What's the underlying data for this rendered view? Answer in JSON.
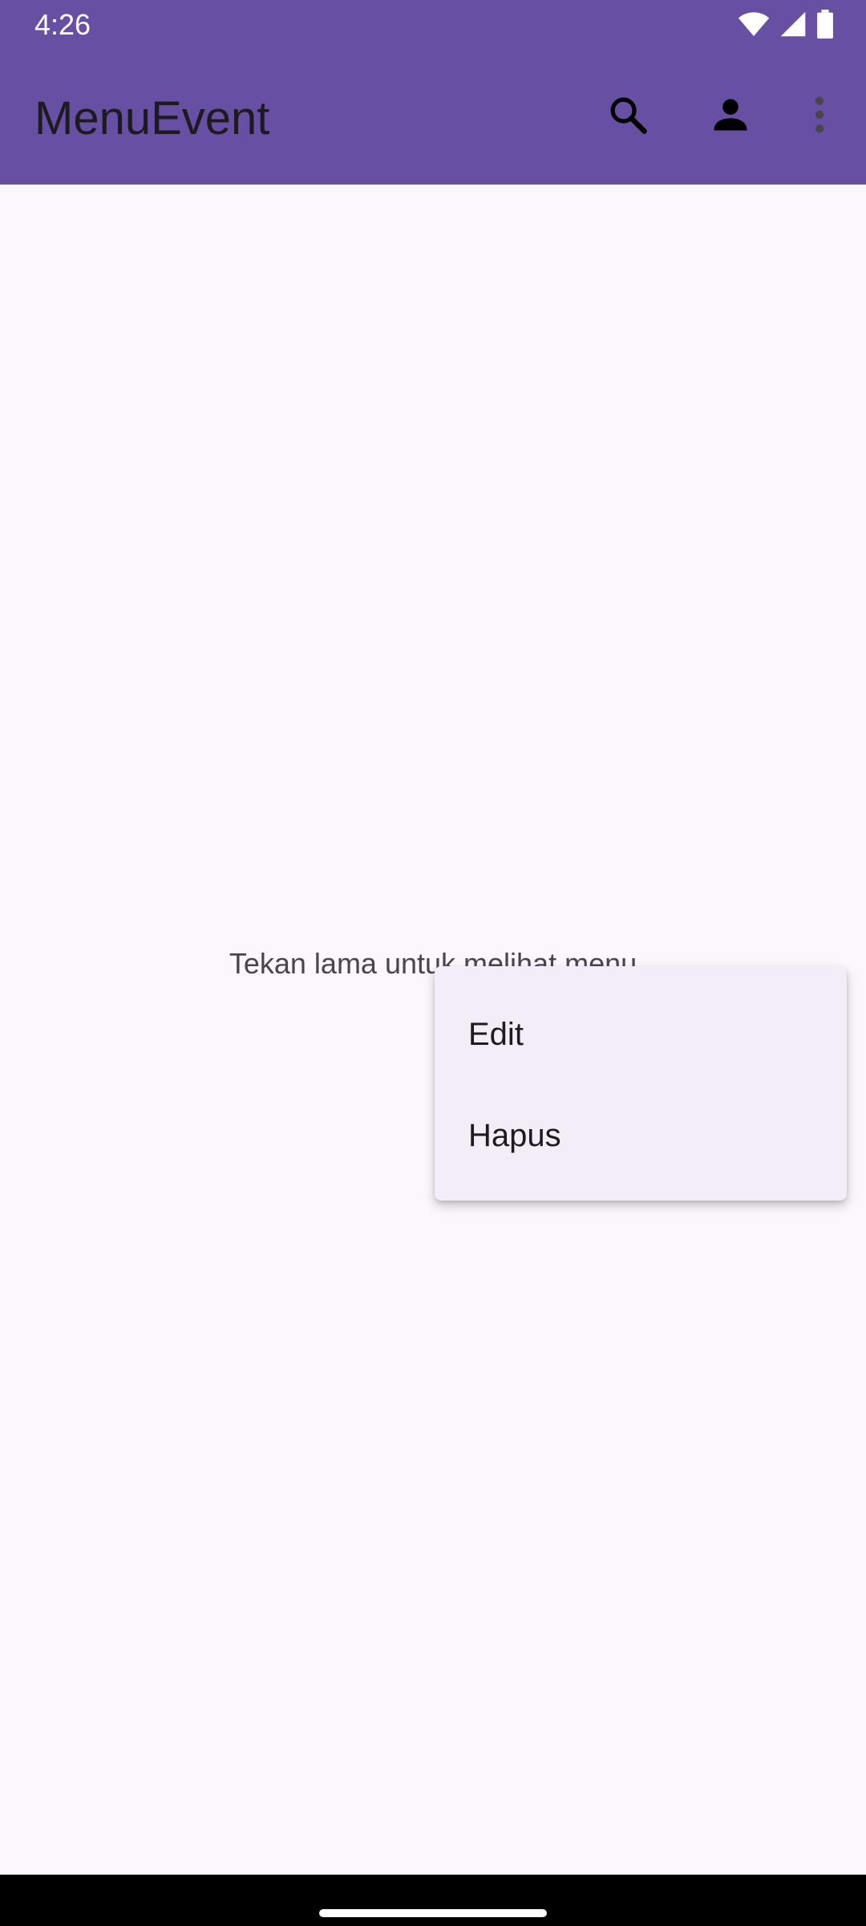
{
  "colors": {
    "app_bar": "#6750A4",
    "background": "#FCF7FC",
    "menu_background": "#F2EDF6",
    "nav_bar": "#000000"
  },
  "status_bar": {
    "time": "4:26",
    "icons": [
      "wifi-icon",
      "cellular-signal-icon",
      "battery-icon"
    ]
  },
  "toolbar": {
    "title": "MenuEvent",
    "actions": [
      "search-icon",
      "person-icon",
      "more-vert-icon"
    ]
  },
  "main": {
    "hint_text": "Tekan lama untuk melihat menu"
  },
  "context_menu": {
    "items": [
      {
        "label": "Edit"
      },
      {
        "label": "Hapus"
      }
    ]
  }
}
